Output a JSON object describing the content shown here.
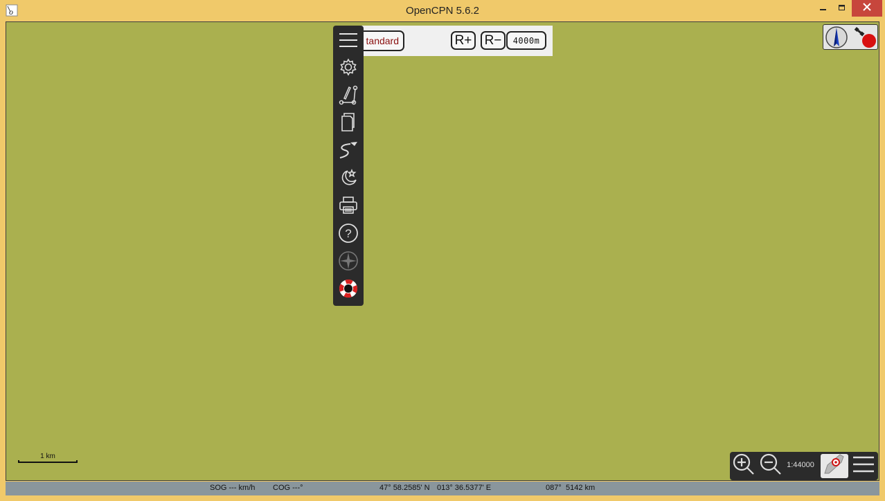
{
  "window": {
    "title": "OpenCPN 5.6.2",
    "app_icon": "opencpn-app-icon",
    "controls": [
      "minimize-icon",
      "maximize-icon",
      "close-icon"
    ]
  },
  "chart": {
    "background_color": "#aab04f"
  },
  "top_toolbar": {
    "chart_group_label": "tandard",
    "range_plus_label": "R+",
    "range_minus_label": "R−",
    "range_value": "4000m"
  },
  "main_toolbar": {
    "items": [
      {
        "icon": "hamburger-menu-icon"
      },
      {
        "icon": "gear-icon"
      },
      {
        "icon": "route-icon"
      },
      {
        "icon": "documents-icon"
      },
      {
        "icon": "track-icon"
      },
      {
        "icon": "night-mode-icon"
      },
      {
        "icon": "printer-icon"
      },
      {
        "icon": "help-icon"
      },
      {
        "icon": "compass-rose-icon"
      },
      {
        "icon": "mob-lifebuoy-icon"
      }
    ]
  },
  "compass_widget": {
    "icons": [
      "north-arrow-icon",
      "gps-satellite-status-icon"
    ],
    "gps_status_color": "#d81010"
  },
  "scale_bar": {
    "label": "1 km"
  },
  "bottom_toolbar": {
    "zoom_in_icon": "zoom-in-icon",
    "zoom_out_icon": "zoom-out-icon",
    "scale_ratio": "1:44000",
    "boat_icon": "own-ship-follow-icon",
    "menu_icon": "hamburger-menu-icon"
  },
  "status_bar": {
    "sog": "SOG --- km/h",
    "cog": "COG ---°",
    "lat": "47° 58.2585' N",
    "lon": "013° 36.5377' E",
    "bearing": "087°",
    "distance": "5142 km"
  }
}
